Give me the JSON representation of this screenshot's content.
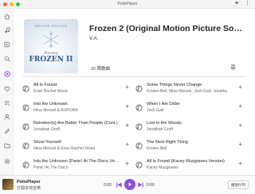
{
  "window": {
    "title": "PolisPlayer"
  },
  "sidebar": {
    "items": [
      {
        "icon": "home-icon"
      },
      {
        "icon": "music-library-icon"
      },
      {
        "icon": "album-icon"
      },
      {
        "icon": "search-icon"
      },
      {
        "icon": "now-playing-icon",
        "active": true
      },
      {
        "icon": "heart-icon"
      },
      {
        "icon": "playlist-icon"
      },
      {
        "icon": "artist-icon"
      },
      {
        "icon": "edit-icon"
      },
      {
        "icon": "folder-icon"
      },
      {
        "icon": "settings-icon"
      }
    ]
  },
  "album": {
    "cover_edition": "DELUXE EDITION",
    "cover_brand": "Disney",
    "cover_title": "FROZEN II",
    "title": "Frozen 2 (Original Motion Picture Soundtrack)",
    "artist": "V.A.",
    "song_count": "16 首歌曲"
  },
  "songs": [
    {
      "title": "All Is Found",
      "artist": "Evan Rachel Wood"
    },
    {
      "title": "Some Things Never Change",
      "artist": "Kristen Bell, Idina Menzel, Josh Gad, Jonathan Groff"
    },
    {
      "title": "Into the Unknown",
      "artist": "Idina Menzel & AURORA"
    },
    {
      "title": "When I Am Older",
      "artist": "Josh Gad"
    },
    {
      "title": "Reindeer(s) Are Better Than People (Cont.)",
      "artist": "Jonathan Groff"
    },
    {
      "title": "Lost in the Woods",
      "artist": "Jonathan Groff"
    },
    {
      "title": "Show Yourself",
      "artist": "Idina Menzel & Evan Rachel Wood"
    },
    {
      "title": "The Next Right Thing",
      "artist": "Kristen Bell"
    },
    {
      "title": "Into the Unknown (Panic! At The Disco Version)",
      "artist": "Panic! At The Disco"
    },
    {
      "title": "All Is Found (Kacey Musgraves Version)",
      "artist": "Kacey Musgraves"
    }
  ],
  "player": {
    "app_name": "PolisPlayer",
    "subtitle": "打開本地音樂",
    "time_current": "0:00",
    "time_total": "0:00",
    "queue_label": "播放佇列"
  },
  "colors": {
    "accent": "#8e4fd6",
    "close": "#ff5f57",
    "minimize": "#febc2e",
    "maximize": "#28c840"
  }
}
